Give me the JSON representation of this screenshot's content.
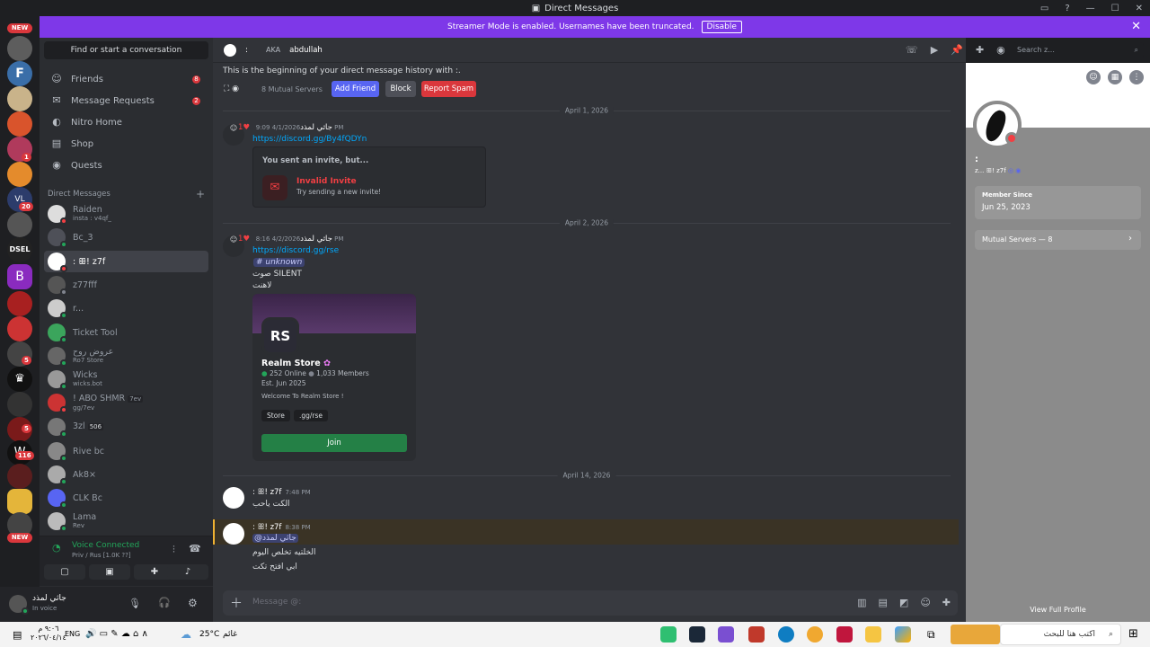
{
  "window": {
    "title": "Direct Messages"
  },
  "banner": {
    "text": "Streamer Mode is enabled. Usernames have been truncated.",
    "button": "Disable"
  },
  "servers": {
    "new_top": "NEW",
    "new_bottom": "NEW",
    "badges": [
      "1",
      "1",
      "20",
      "5",
      "5",
      "2",
      "116",
      "1",
      "1",
      "3",
      "5"
    ]
  },
  "sidebar": {
    "search": "Find or start a conversation",
    "nav": [
      {
        "label": "Friends",
        "count": "8"
      },
      {
        "label": "Message Requests",
        "count": "2"
      },
      {
        "label": "Nitro Home"
      },
      {
        "label": "Shop"
      },
      {
        "label": "Quests"
      }
    ],
    "dm_header": "Direct Messages",
    "dms": [
      {
        "name": "Raiden",
        "sub": "insta : v4qf_"
      },
      {
        "name": "Bc_3",
        "sub": ""
      },
      {
        "name": ": ꕥ! z7f",
        "sub": ""
      },
      {
        "name": "z77fff",
        "sub": ""
      },
      {
        "name": "r...",
        "sub": ""
      },
      {
        "name": "Ticket Tool",
        "sub": ""
      },
      {
        "name": "عروض روح",
        "sub": "Ro7 Store"
      },
      {
        "name": "Wicks",
        "sub": "wicks.bot"
      },
      {
        "name": "! ABO SHMR",
        "sub": "gg/7ev",
        "tag": "7ev"
      },
      {
        "name": "3zl",
        "sub": "",
        "tag": "506"
      },
      {
        "name": "Rive bc",
        "sub": ""
      },
      {
        "name": "Ak8×",
        "sub": ""
      },
      {
        "name": "CLK Bc",
        "sub": ""
      },
      {
        "name": "Lama",
        "sub": "Rev"
      }
    ]
  },
  "voice": {
    "title": "Voice Connected",
    "sub": "Priv / Rus [1.0K ??]"
  },
  "user": {
    "name": "جاثي لمذد",
    "status": "In voice"
  },
  "header": {
    "name": ":",
    "aka": "AKA",
    "alias": "abdullah",
    "search": "Search z..."
  },
  "chat": {
    "intro": "This is the beginning of your direct message history with :.",
    "mutual": "8 Mutual Servers",
    "add_friend": "Add Friend",
    "block": "Block",
    "report": "Report Spam",
    "days": [
      "April 1, 2026",
      "April 2, 2026",
      "April 14, 2026"
    ],
    "m1": {
      "user": "جاثي لمذد",
      "time": "4/1/2026 9:09 PM",
      "link": "https://discord.gg/By4fQDYn"
    },
    "invite": {
      "head": "You sent an invite, but...",
      "title": "Invalid Invite",
      "sub": "Try sending a new invite!"
    },
    "m2": {
      "user": "جاثي لمذد",
      "time": "4/2/2026 8:16 PM",
      "link": "https://discord.gg/rse",
      "channel": "# unknown",
      "l1": "صوت SILENT",
      "l2": "لاهنت"
    },
    "realm": {
      "name": "Realm Store",
      "online": "252 Online",
      "members": "1,033 Members",
      "est": "Est. Jun 2025",
      "desc": "Welcome To Realm Store !",
      "tag1": "Store",
      "tag2": ".gg/rse",
      "join": "Join"
    },
    "m3": {
      "user": ": ꕥ! z7f",
      "time": "7:48 PM",
      "text": "الكت ياحب"
    },
    "m4": {
      "user": ": ꕥ! z7f",
      "time": "8:38 PM",
      "mention": "@جاثي لمذد",
      "l1": "الخلتيه تخلص اليوم",
      "l2": "ابي افتح تكت"
    },
    "composer": "Message @:"
  },
  "profile": {
    "name": ":",
    "tag": "z... ꕥ! z7f",
    "member_since_label": "Member Since",
    "member_since": "Jun 25, 2023",
    "mutual": "Mutual Servers — 8",
    "view_full": "View Full Profile"
  },
  "taskbar": {
    "date": "٢٠٢٦/٠٤/١٤",
    "time": "٩:٠٦ م",
    "lang": "ENG",
    "weather": "25°C",
    "weather_text": "غائم",
    "search": "اكتب هنا للبحث"
  }
}
